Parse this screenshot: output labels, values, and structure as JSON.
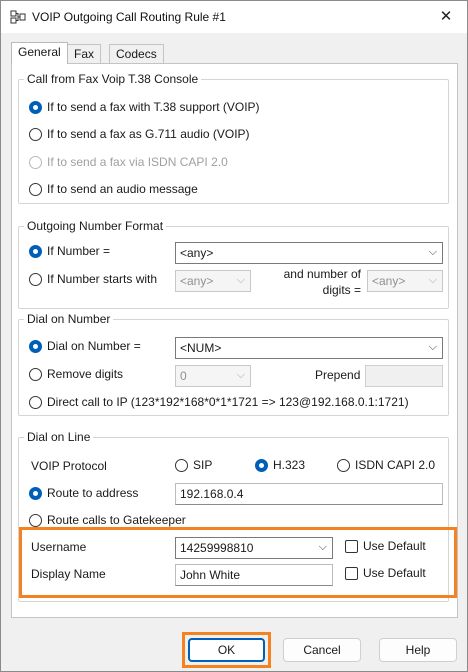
{
  "window": {
    "title": "VOIP Outgoing Call Routing Rule #1",
    "icon": "routing-rule-icon",
    "close_glyph": "✕"
  },
  "tabs": [
    {
      "label": "General",
      "active": true
    },
    {
      "label": "Fax",
      "active": false
    },
    {
      "label": "Codecs",
      "active": false
    }
  ],
  "call_from_fax": {
    "title": "Call from Fax Voip T.38 Console",
    "options": [
      {
        "label": "If to send a fax with T.38 support (VOIP)",
        "selected": true,
        "enabled": true
      },
      {
        "label": "If to send a fax as G.711 audio (VOIP)",
        "selected": false,
        "enabled": true
      },
      {
        "label": "If to send a fax via ISDN CAPI 2.0",
        "selected": false,
        "enabled": false
      },
      {
        "label": "If to send an audio message",
        "selected": false,
        "enabled": true
      }
    ]
  },
  "outgoing_number": {
    "title": "Outgoing Number Format",
    "if_number_label": "If Number =",
    "if_number_value": "<any>",
    "starts_with_label": "If Number starts with",
    "starts_with_value": "<any>",
    "digits_label_1": "and number of",
    "digits_label_2": "digits =",
    "digits_value": "<any>"
  },
  "dial_on_number": {
    "title": "Dial on Number",
    "dial_label": "Dial on Number =",
    "dial_value": "<NUM>",
    "remove_label": "Remove digits",
    "remove_value": "0",
    "prepend_label": "Prepend",
    "prepend_value": "",
    "direct_label": "Direct call to IP (123*192*168*0*1*1721 => 123@192.168.0.1:1721)"
  },
  "dial_on_line": {
    "title": "Dial on Line",
    "protocol_label": "VOIP Protocol",
    "protocols": [
      {
        "label": "SIP",
        "selected": false
      },
      {
        "label": "H.323",
        "selected": true
      },
      {
        "label": "ISDN CAPI 2.0",
        "selected": false
      }
    ],
    "route_address_label": "Route to address",
    "route_address_value": "192.168.0.4",
    "gatekeeper_label": "Route calls to Gatekeeper",
    "username_label": "Username",
    "username_value": "14259998810",
    "display_name_label": "Display Name",
    "display_name_value": "John White",
    "use_default_label": "Use Default"
  },
  "buttons": {
    "ok": "OK",
    "cancel": "Cancel",
    "help": "Help"
  },
  "colors": {
    "accent": "#005fb8",
    "highlight": "#f58220"
  }
}
